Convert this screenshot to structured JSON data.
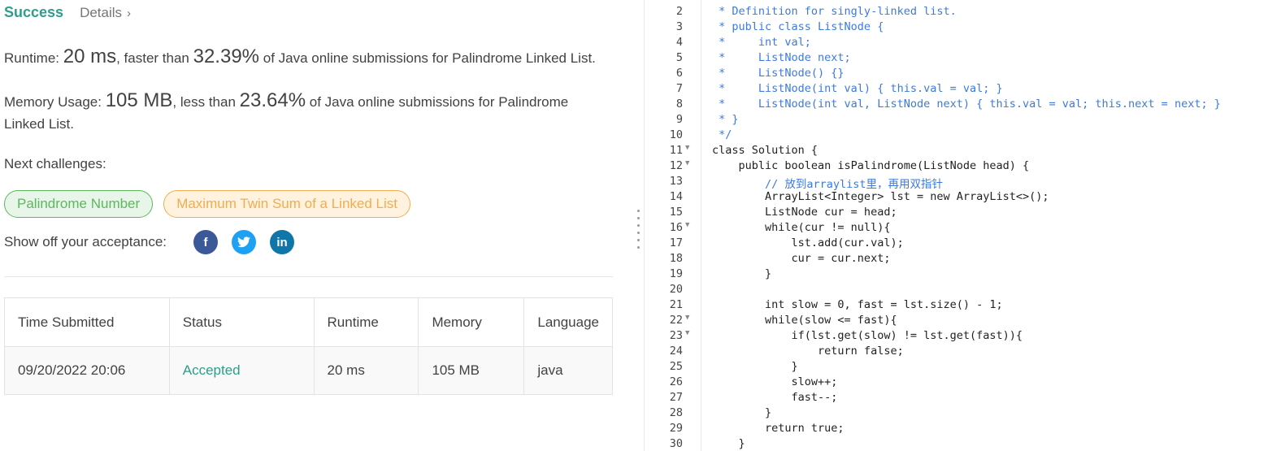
{
  "result": {
    "status": "Success",
    "details_link": "Details",
    "details_chevron": "›"
  },
  "runtime": {
    "label": "Runtime: ",
    "value": "20 ms",
    "mid": ", faster than ",
    "percent": "32.39%",
    "tail": " of Java online submissions for Palindrome Linked List."
  },
  "memory": {
    "label": "Memory Usage: ",
    "value": "105 MB",
    "mid": ", less than ",
    "percent": "23.64%",
    "tail1": " of Java online submissions for Palindrome",
    "tail2": "Linked List."
  },
  "next_challenges": {
    "label": "Next challenges:",
    "items": [
      "Palindrome Number",
      "Maximum Twin Sum of a Linked List"
    ]
  },
  "share": {
    "label": "Show off your acceptance:",
    "icons": {
      "facebook": "f",
      "twitter": "t",
      "linkedin": "in"
    }
  },
  "submissions": {
    "headers": [
      "Time Submitted",
      "Status",
      "Runtime",
      "Memory",
      "Language"
    ],
    "rows": [
      {
        "time": "09/20/2022 20:06",
        "status": "Accepted",
        "runtime": "20 ms",
        "memory": "105 MB",
        "language": "java"
      }
    ]
  },
  "code": {
    "lines": [
      {
        "n": "2",
        "fold": false,
        "t": " * Definition for singly-linked list.",
        "cls": "c-comment"
      },
      {
        "n": "3",
        "fold": false,
        "t": " * public class ListNode {",
        "cls": "c-comment"
      },
      {
        "n": "4",
        "fold": false,
        "t": " *     int val;",
        "cls": "c-comment"
      },
      {
        "n": "5",
        "fold": false,
        "t": " *     ListNode next;",
        "cls": "c-comment"
      },
      {
        "n": "6",
        "fold": false,
        "t": " *     ListNode() {}",
        "cls": "c-comment"
      },
      {
        "n": "7",
        "fold": false,
        "t": " *     ListNode(int val) { this.val = val; }",
        "cls": "c-comment"
      },
      {
        "n": "8",
        "fold": false,
        "t": " *     ListNode(int val, ListNode next) { this.val = val; this.next = next; }",
        "cls": "c-comment"
      },
      {
        "n": "9",
        "fold": false,
        "t": " * }",
        "cls": "c-comment"
      },
      {
        "n": "10",
        "fold": false,
        "t": " */",
        "cls": "c-comment"
      },
      {
        "n": "11",
        "fold": true,
        "t": "class Solution {",
        "cls": ""
      },
      {
        "n": "12",
        "fold": true,
        "t": "    public boolean isPalindrome(ListNode head) {",
        "cls": ""
      },
      {
        "n": "13",
        "fold": false,
        "t": "        // 放到arraylist里，再用双指针",
        "cls": "c-comment"
      },
      {
        "n": "14",
        "fold": false,
        "t": "        ArrayList<Integer> lst = new ArrayList<>();",
        "cls": ""
      },
      {
        "n": "15",
        "fold": false,
        "t": "        ListNode cur = head;",
        "cls": ""
      },
      {
        "n": "16",
        "fold": true,
        "t": "        while(cur != null){",
        "cls": ""
      },
      {
        "n": "17",
        "fold": false,
        "t": "            lst.add(cur.val);",
        "cls": ""
      },
      {
        "n": "18",
        "fold": false,
        "t": "            cur = cur.next;",
        "cls": ""
      },
      {
        "n": "19",
        "fold": false,
        "t": "        }",
        "cls": ""
      },
      {
        "n": "20",
        "fold": false,
        "t": "",
        "cls": ""
      },
      {
        "n": "21",
        "fold": false,
        "t": "        int slow = 0, fast = lst.size() - 1;",
        "cls": ""
      },
      {
        "n": "22",
        "fold": true,
        "t": "        while(slow <= fast){",
        "cls": ""
      },
      {
        "n": "23",
        "fold": true,
        "t": "            if(lst.get(slow) != lst.get(fast)){",
        "cls": ""
      },
      {
        "n": "24",
        "fold": false,
        "t": "                return false;",
        "cls": ""
      },
      {
        "n": "25",
        "fold": false,
        "t": "            }",
        "cls": ""
      },
      {
        "n": "26",
        "fold": false,
        "t": "            slow++;",
        "cls": ""
      },
      {
        "n": "27",
        "fold": false,
        "t": "            fast--;",
        "cls": ""
      },
      {
        "n": "28",
        "fold": false,
        "t": "        }",
        "cls": ""
      },
      {
        "n": "29",
        "fold": false,
        "t": "        return true;",
        "cls": ""
      },
      {
        "n": "30",
        "fold": false,
        "t": "    }",
        "cls": ""
      }
    ]
  }
}
